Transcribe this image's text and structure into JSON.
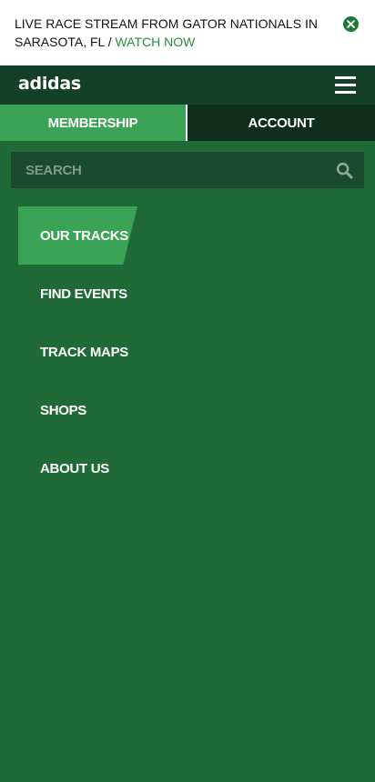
{
  "banner": {
    "text": "LIVE RACE STREAM FROM GATOR NATIONALS IN SARASOTA, FL / ",
    "link": "WATCH NOW"
  },
  "header": {
    "logo": "adidas"
  },
  "tabs": {
    "membership": "MEMBERSHIP",
    "account": "ACCOUNT",
    "active": "MEMBERSHIP"
  },
  "search": {
    "placeholder": "SEARCH"
  },
  "nav": {
    "items": [
      {
        "label": "OUR TRACKS",
        "active": true
      },
      {
        "label": "FIND EVENTS",
        "active": false
      },
      {
        "label": "TRACK MAPS",
        "active": false
      },
      {
        "label": "SHOPS",
        "active": false
      },
      {
        "label": "ABOUT US",
        "active": false
      }
    ]
  },
  "colors": {
    "brand_green": "#3aa356",
    "dark_green": "#14402a",
    "menu_background": "#1f6a36",
    "link_green": "#2a8c3d"
  },
  "icons": [
    "close-circle-icon",
    "hamburger-menu-icon",
    "search-icon"
  ]
}
